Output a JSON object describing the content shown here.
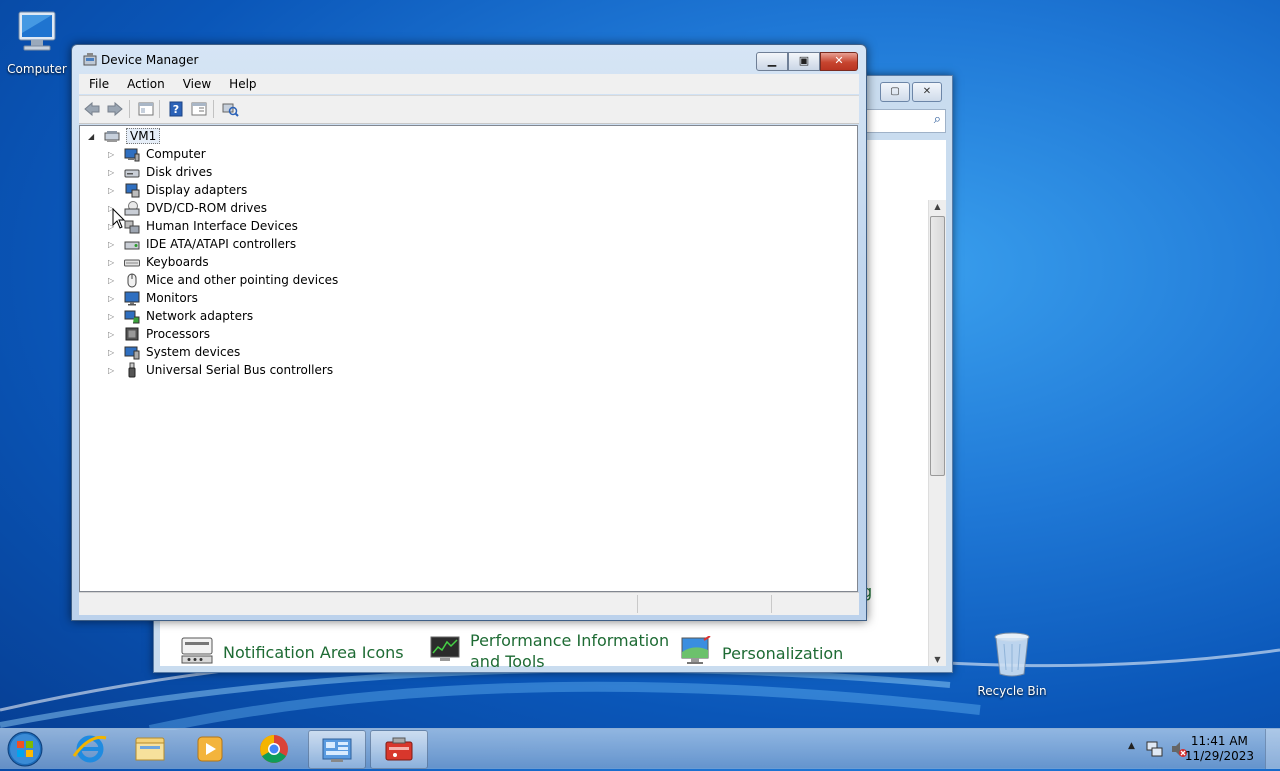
{
  "desktop": {
    "icons": [
      {
        "label": "Computer",
        "icon": "computer-icon"
      },
      {
        "label": "Recycle Bin",
        "icon": "recycle-bin-icon"
      }
    ]
  },
  "background_window": {
    "items": [
      {
        "label_line1": "Notification Area Icons",
        "label_line2": "",
        "icon": "notification-area-icon"
      },
      {
        "label_line1": "Performance Information",
        "label_line2": "and Tools",
        "icon": "performance-icon"
      },
      {
        "label_line1": "Personalization",
        "label_line2": "",
        "icon": "personalization-icon"
      }
    ],
    "cut_text": "g"
  },
  "device_manager": {
    "title": "Device Manager",
    "menu": [
      "File",
      "Action",
      "View",
      "Help"
    ],
    "toolbar": [
      "back-arrow-icon",
      "forward-arrow-icon",
      "show-hide-console-tree-icon",
      "help-icon",
      "properties-icon",
      "scan-hardware-icon"
    ],
    "root": "VM1",
    "categories": [
      {
        "label": "Computer",
        "icon": "computer-icon"
      },
      {
        "label": "Disk drives",
        "icon": "disk-drive-icon"
      },
      {
        "label": "Display adapters",
        "icon": "display-adapter-icon"
      },
      {
        "label": "DVD/CD-ROM drives",
        "icon": "dvd-drive-icon"
      },
      {
        "label": "Human Interface Devices",
        "icon": "hid-icon"
      },
      {
        "label": "IDE ATA/ATAPI controllers",
        "icon": "ide-controller-icon"
      },
      {
        "label": "Keyboards",
        "icon": "keyboard-icon"
      },
      {
        "label": "Mice and other pointing devices",
        "icon": "mouse-icon"
      },
      {
        "label": "Monitors",
        "icon": "monitor-icon"
      },
      {
        "label": "Network adapters",
        "icon": "network-adapter-icon"
      },
      {
        "label": "Processors",
        "icon": "processor-icon"
      },
      {
        "label": "System devices",
        "icon": "system-devices-icon"
      },
      {
        "label": "Universal Serial Bus controllers",
        "icon": "usb-controller-icon"
      }
    ]
  },
  "taskbar": {
    "apps": [
      "start-orb",
      "internet-explorer",
      "windows-explorer",
      "media-player",
      "chrome",
      "control-panel",
      "device-manager"
    ],
    "clock_time": "11:41 AM",
    "clock_date": "11/29/2023"
  }
}
